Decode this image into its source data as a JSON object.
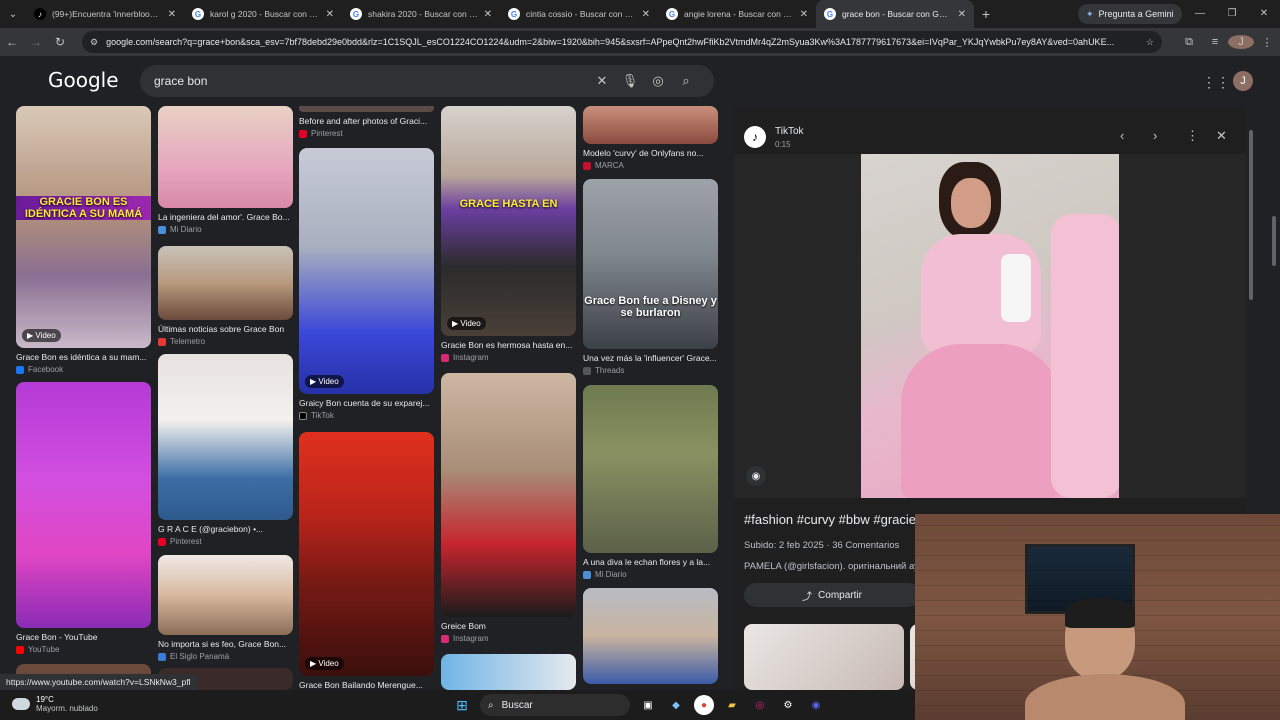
{
  "tabs": [
    {
      "label": "(99+)Encuentra 'innerbloom' e",
      "icon": "tiktok-icon"
    },
    {
      "label": "karol g 2020 - Buscar con Goog",
      "icon": "google-icon"
    },
    {
      "label": "shakira 2020 - Buscar con Goog",
      "icon": "google-icon"
    },
    {
      "label": "cintia cossio - Buscar con Goog",
      "icon": "google-icon"
    },
    {
      "label": "angie lorena - Buscar con Goog",
      "icon": "google-icon"
    },
    {
      "label": "grace bon - Buscar con Google",
      "icon": "google-icon"
    }
  ],
  "gemini_label": "Pregunta a Gemini",
  "address_url": "google.com/search?q=grace+bon&sca_esv=7bf78debd29e0bdd&rlz=1C1SQJL_esCO1224CO1224&udm=2&biw=1920&bih=945&sxsrf=APpeQnt2hwFfiKb2VtmdMr4qZ2mSyua3Kw%3A1787779617673&ei=IVqPar_YKJqYwbkPu7ey8AY&ved=0ahUKE...",
  "profile_initial": "J",
  "logo": "Google",
  "search": {
    "query": "grace bon"
  },
  "results": [
    {
      "img_text": "GRACIE BON ES IDÉNTICA A SU MAMÁ",
      "video": "Video",
      "caption": "Grace Bon es idéntica a su mam...",
      "source": "Facebook",
      "src_color": "#1877f2"
    },
    {
      "img_text": "",
      "video": "",
      "caption": "Grace Bon - YouTube",
      "source": "YouTube",
      "src_color": "#ff0000"
    },
    {
      "img_text": "",
      "video": "",
      "caption": "La ingeniera del amor'. Grace Bo...",
      "source": "Mi Diario",
      "src_color": "#4a90d9"
    },
    {
      "img_text": "",
      "video": "",
      "caption": "Últimas noticias sobre Grace Bon",
      "source": "Telemetro",
      "src_color": "#e53935"
    },
    {
      "img_text": "",
      "video": "",
      "caption": "G R A C E (@graciebon) •...",
      "source": "Pinterest",
      "src_color": "#e60023"
    },
    {
      "img_text": "",
      "video": "",
      "caption": "No importa si es feo, Grace Bon...",
      "source": "El Siglo Panamá",
      "src_color": "#3a7bd5"
    },
    {
      "img_text": "",
      "video": "",
      "caption": "Before and after photos of Graci...",
      "source": "Pinterest",
      "src_color": "#e60023"
    },
    {
      "img_text": "",
      "video": "Video",
      "caption": "Graicy Bon cuenta de su exparej...",
      "source": "TikTok",
      "src_color": "#000000"
    },
    {
      "img_text": "",
      "video": "Video",
      "caption": "Grace Bon Bailando Merengue...",
      "source": "",
      "src_color": "#000000"
    },
    {
      "img_text": "GRACE HASTA EN",
      "video": "Video",
      "caption": "Gracie Bon es hermosa hasta en...",
      "source": "Instagram",
      "src_color": "#d62976"
    },
    {
      "img_text": "",
      "video": "",
      "caption": "Greice Bom",
      "source": "Instagram",
      "src_color": "#d62976"
    },
    {
      "img_text": "",
      "video": "",
      "caption": "Modelo 'curvy' de Onlyfans no...",
      "source": "MARCA",
      "src_color": "#c8102e"
    },
    {
      "img_text": "Grace Bon fue a Disney y se burlaron",
      "video": "",
      "caption": "Una vez más la 'influencer' Grace...",
      "source": "Threads",
      "src_color": "#555555"
    },
    {
      "img_text": "",
      "video": "",
      "caption": "A una diva le echan flores y a la...",
      "source": "Mi Diario",
      "src_color": "#4a90d9"
    }
  ],
  "panel": {
    "source": "TikTok",
    "duration": "0:15",
    "title": "#fashion #curvy #bbw #gracieb",
    "meta": "Subido: 2 feb 2025 · 36 Comentarios",
    "author": "PAMELA (@girlsfacion). оригінальний ау",
    "share_label": "Compartir"
  },
  "status_url": "https://www.youtube.com/watch?v=LSNkNw3_pfl",
  "taskbar": {
    "temp": "19°C",
    "weather_desc": "Mayorm. nublado",
    "search_label": "Buscar"
  }
}
